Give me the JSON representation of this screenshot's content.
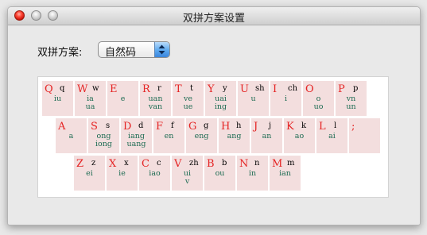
{
  "window": {
    "title": "双拼方案设置"
  },
  "scheme": {
    "label": "双拼方案:",
    "selected": "自然码"
  },
  "keyboard": {
    "rows": [
      [
        {
          "letter": "Q",
          "initial": "q",
          "finals": [
            "iu"
          ]
        },
        {
          "letter": "W",
          "initial": "w",
          "finals": [
            "ia",
            "ua"
          ]
        },
        {
          "letter": "E",
          "initial": "",
          "finals": [
            "e"
          ]
        },
        {
          "letter": "R",
          "initial": "r",
          "finals": [
            "uan",
            "van"
          ]
        },
        {
          "letter": "T",
          "initial": "t",
          "finals": [
            "ve",
            "ue"
          ]
        },
        {
          "letter": "Y",
          "initial": "y",
          "finals": [
            "uai",
            "ing"
          ]
        },
        {
          "letter": "U",
          "initial": "sh",
          "finals": [
            "u"
          ]
        },
        {
          "letter": "I",
          "initial": "ch",
          "finals": [
            "i"
          ]
        },
        {
          "letter": "O",
          "initial": "",
          "finals": [
            "o",
            "uo"
          ]
        },
        {
          "letter": "P",
          "initial": "p",
          "finals": [
            "vn",
            "un"
          ]
        }
      ],
      [
        {
          "letter": "A",
          "initial": "",
          "finals": [
            "a"
          ]
        },
        {
          "letter": "S",
          "initial": "s",
          "finals": [
            "ong",
            "iong"
          ]
        },
        {
          "letter": "D",
          "initial": "d",
          "finals": [
            "iang",
            "uang"
          ]
        },
        {
          "letter": "F",
          "initial": "f",
          "finals": [
            "en"
          ]
        },
        {
          "letter": "G",
          "initial": "g",
          "finals": [
            "eng"
          ]
        },
        {
          "letter": "H",
          "initial": "h",
          "finals": [
            "ang"
          ]
        },
        {
          "letter": "J",
          "initial": "j",
          "finals": [
            "an"
          ]
        },
        {
          "letter": "K",
          "initial": "k",
          "finals": [
            "ao"
          ]
        },
        {
          "letter": "L",
          "initial": "l",
          "finals": [
            "ai"
          ]
        },
        {
          "letter": ";",
          "initial": "",
          "finals": []
        }
      ],
      [
        {
          "letter": "Z",
          "initial": "z",
          "finals": [
            "ei"
          ]
        },
        {
          "letter": "X",
          "initial": "x",
          "finals": [
            "ie"
          ]
        },
        {
          "letter": "C",
          "initial": "c",
          "finals": [
            "iao"
          ]
        },
        {
          "letter": "V",
          "initial": "zh",
          "finals": [
            "ui",
            "v"
          ]
        },
        {
          "letter": "B",
          "initial": "b",
          "finals": [
            "ou"
          ]
        },
        {
          "letter": "N",
          "initial": "n",
          "finals": [
            "in"
          ]
        },
        {
          "letter": "M",
          "initial": "m",
          "finals": [
            "ian"
          ]
        }
      ]
    ]
  }
}
